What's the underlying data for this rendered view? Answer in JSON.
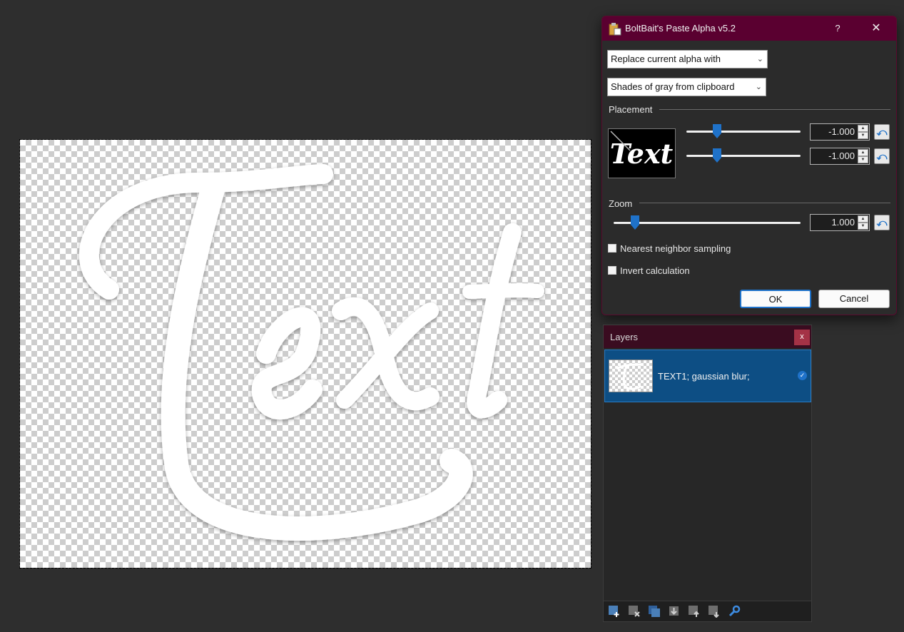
{
  "dialog": {
    "title": "BoltBait's Paste Alpha v5.2",
    "help_label": "?",
    "close_label": "✕",
    "mode_select": "Replace current alpha with",
    "source_select": "Shades of gray from clipboard",
    "placement_label": "Placement",
    "placement_x_value": "-1.000",
    "placement_y_value": "-1.000",
    "zoom_label": "Zoom",
    "zoom_value": "1.000",
    "nearest_neighbor_label": "Nearest neighbor sampling",
    "invert_label": "Invert calculation",
    "ok_label": "OK",
    "cancel_label": "Cancel",
    "reset_icon": "⤺",
    "preview_text": "Text"
  },
  "canvas": {
    "text": "Text"
  },
  "layers": {
    "title": "Layers",
    "close_label": "x",
    "items": [
      {
        "name": "TEXT1; gaussian blur;",
        "visible": true
      }
    ],
    "toolbar": [
      "add-layer-icon",
      "delete-layer-icon",
      "duplicate-layer-icon",
      "merge-down-icon",
      "move-up-icon",
      "move-down-icon",
      "properties-icon"
    ]
  },
  "colors": {
    "titlebar": "#5a0030",
    "accent": "#1f72c9",
    "selected_layer": "#0d4e84"
  }
}
